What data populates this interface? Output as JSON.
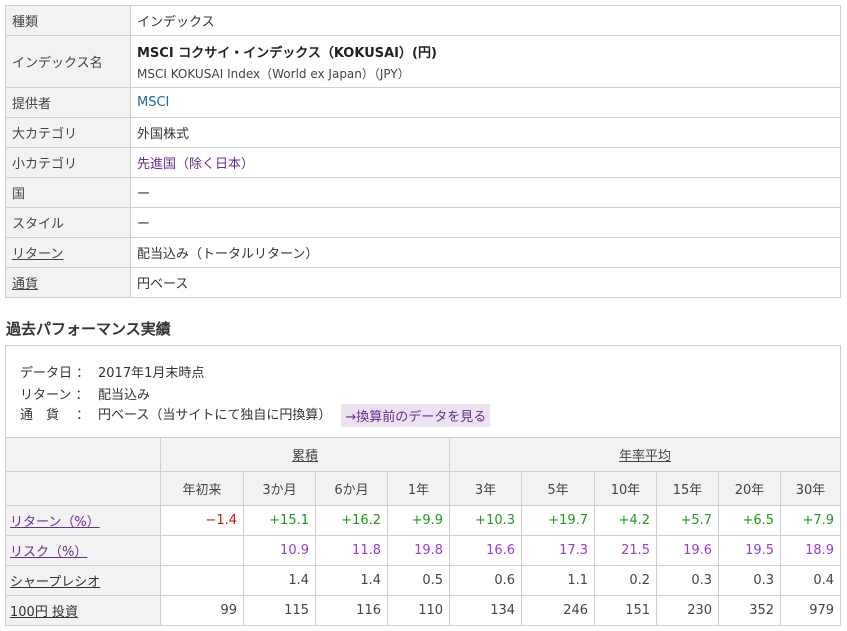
{
  "info": {
    "rows": [
      {
        "label": "種類",
        "value": "インデックス"
      },
      {
        "label": "インデックス名",
        "value": "MSCI コクサイ・インデックス（KOKUSAI）(円)",
        "sub": "MSCI KOKUSAI Index（World ex Japan）（JPY）"
      },
      {
        "label": "提供者",
        "value": "MSCI"
      },
      {
        "label": "大カテゴリ",
        "value": "外国株式"
      },
      {
        "label": "小カテゴリ",
        "value": "先進国（除く日本）"
      },
      {
        "label": "国",
        "value": "ー"
      },
      {
        "label": "スタイル",
        "value": "ー"
      },
      {
        "label": "リターン",
        "value": "配当込み（トータルリターン）"
      },
      {
        "label": "通貨",
        "value": "円ベース"
      }
    ]
  },
  "performance": {
    "title": "過去パフォーマンス実績",
    "meta": {
      "date_key": "データ日 ：",
      "date_val": "2017年1月末時点",
      "return_key": "リターン ：",
      "return_val": "配当込み",
      "currency_key": "通　貨　 ：",
      "currency_val": "円ベース（当サイトにて独自に円換算）",
      "convert_link": "→換算前のデータを見る"
    },
    "groups": {
      "cumulative": "累積",
      "annual": "年率平均"
    },
    "periods": [
      "年初来",
      "3か月",
      "6か月",
      "1年",
      "3年",
      "5年",
      "10年",
      "15年",
      "20年",
      "30年"
    ],
    "rows": [
      {
        "label": "リターン（%）",
        "cells": [
          "−1.4",
          "+15.1",
          "+16.2",
          "+9.9",
          "+10.3",
          "+19.7",
          "+4.2",
          "+5.7",
          "+6.5",
          "+7.9"
        ]
      },
      {
        "label": "リスク（%）",
        "cells": [
          "",
          "10.9",
          "11.8",
          "19.8",
          "16.6",
          "17.3",
          "21.5",
          "19.6",
          "19.5",
          "18.9"
        ]
      },
      {
        "label": "シャープレシオ",
        "cells": [
          "",
          "1.4",
          "1.4",
          "0.5",
          "0.6",
          "1.1",
          "0.2",
          "0.3",
          "0.3",
          "0.4"
        ]
      },
      {
        "label": "100円 投資",
        "cells": [
          "99",
          "115",
          "116",
          "110",
          "134",
          "246",
          "151",
          "230",
          "352",
          "979"
        ]
      }
    ]
  },
  "colors": {
    "positive": "#1e9a1e",
    "negative": "#cc1111",
    "risk": "#9b3ad6",
    "link": "#1a6aa8"
  }
}
